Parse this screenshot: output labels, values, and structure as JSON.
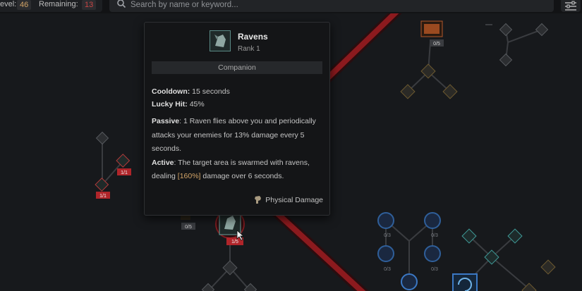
{
  "header": {
    "level_label": "evel:",
    "level_value": "46",
    "remaining_label": "Remaining:",
    "remaining_value": "13",
    "search_placeholder": "Search by name or keyword..."
  },
  "tooltip": {
    "skill_name": "Ravens",
    "rank": "Rank 1",
    "tag": "Companion",
    "cooldown_label": "Cooldown:",
    "cooldown_value": "15 seconds",
    "lucky_label": "Lucky Hit:",
    "lucky_value": "45%",
    "passive_label": "Passive",
    "passive_text": ": 1 Raven flies above you and periodically attacks your enemies for 13% damage every 5 seconds.",
    "active_label": "Active",
    "active_text_1": ": The target area is swarmed with ravens, dealing ",
    "active_value": "[160%]",
    "active_text_2": " damage over 6 seconds.",
    "damage_type": "Physical Damage"
  },
  "nodes": {
    "top_orange_count": "0/5",
    "left_a_count": "1/1",
    "left_b_count": "1/1",
    "under_tooltip_count": "0/5",
    "ravens_count": "1/5",
    "blue_1_count": "0/3",
    "blue_2_count": "0/3",
    "blue_3_count": "0/3",
    "blue_4_count": "0/3"
  },
  "colors": {
    "background": "#17191c",
    "panel": "#141517",
    "accent_red": "#c0262b",
    "highlight": "#d3a467",
    "teal": "#3f9a98",
    "blue": "#2f5f9a"
  }
}
